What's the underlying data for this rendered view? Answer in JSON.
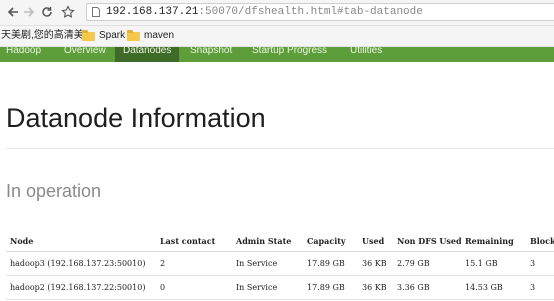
{
  "browser": {
    "url_host": "192.168.137.21",
    "url_rest": ":50070/dfshealth.html#tab-datanode",
    "bookmarks": [
      {
        "label": "天美剧,您的高清美",
        "icon": "page-icon"
      },
      {
        "label": "Spark",
        "icon": "folder-icon"
      },
      {
        "label": "maven",
        "icon": "folder-icon"
      }
    ]
  },
  "nav": {
    "tabs": [
      {
        "label": "Hadoop"
      },
      {
        "label": "Overview"
      },
      {
        "label": "Datanodes",
        "active": true
      },
      {
        "label": "Snapshot"
      },
      {
        "label": "Startup Progress"
      },
      {
        "label": "Utilities"
      }
    ]
  },
  "page": {
    "title": "Datanode Information",
    "section": "In operation"
  },
  "table": {
    "columns": [
      "Node",
      "Last contact",
      "Admin State",
      "Capacity",
      "Used",
      "Non DFS Used",
      "Remaining",
      "Blocks"
    ],
    "rows": [
      [
        "hadoop3 (192.168.137.23:50010)",
        "2",
        "In Service",
        "17.89 GB",
        "36 KB",
        "2.79 GB",
        "15.1 GB",
        "3"
      ],
      [
        "hadoop2 (192.168.137.22:50010)",
        "0",
        "In Service",
        "17.89 GB",
        "36 KB",
        "3.36 GB",
        "14.53 GB",
        "3"
      ]
    ]
  }
}
